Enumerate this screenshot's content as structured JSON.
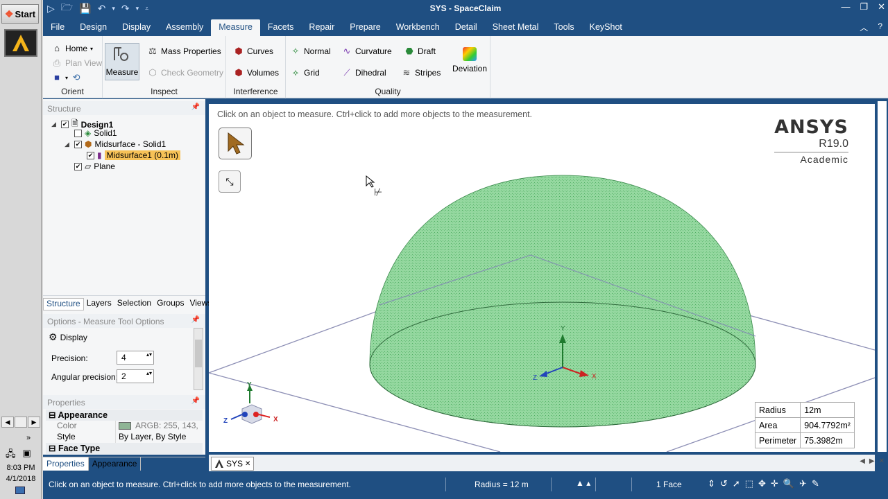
{
  "taskbar": {
    "start_label": "Start",
    "clock_time": "8:03 PM",
    "clock_date": "4/1/2018"
  },
  "window": {
    "title": "SYS - SpaceClaim"
  },
  "ribbon_tabs": [
    "File",
    "Design",
    "Display",
    "Assembly",
    "Measure",
    "Facets",
    "Repair",
    "Prepare",
    "Workbench",
    "Detail",
    "Sheet Metal",
    "Tools",
    "KeyShot"
  ],
  "ribbon": {
    "orient": {
      "label": "Orient",
      "home": "Home",
      "plan_view": "Plan View"
    },
    "inspect": {
      "label": "Inspect",
      "measure": "Measure",
      "mass_properties": "Mass Properties",
      "check_geometry": "Check Geometry"
    },
    "interference": {
      "label": "Interference",
      "curves": "Curves",
      "volumes": "Volumes"
    },
    "quality": {
      "label": "Quality",
      "normal": "Normal",
      "grid": "Grid",
      "curvature": "Curvature",
      "dihedral": "Dihedral",
      "draft": "Draft",
      "stripes": "Stripes",
      "deviation": "Deviation"
    }
  },
  "structure": {
    "header": "Structure",
    "design": "Design1",
    "solid": "Solid1",
    "midsurface": "Midsurface - Solid1",
    "midsurface_child": "Midsurface1 (0.1m)",
    "plane": "Plane"
  },
  "panel_tabs": [
    "Structure",
    "Layers",
    "Selection",
    "Groups",
    "Views"
  ],
  "options": {
    "header": "Options - Measure Tool Options",
    "display": "Display",
    "precision_label": "Precision:",
    "precision_value": "4",
    "angular_label": "Angular precision:",
    "angular_value": "2"
  },
  "properties": {
    "header": "Properties",
    "appearance": "Appearance",
    "color_key": "Color",
    "color_val": "ARGB: 255, 143,",
    "style_key": "Style",
    "style_val": "By Layer, By Style",
    "face_type": "Face Type",
    "swatch": "#8fb595"
  },
  "bottom_tabs": [
    "Properties",
    "Appearance"
  ],
  "viewport": {
    "hint": "Click on an object to measure.  Ctrl+click to add more objects to the measurement.",
    "logo_name": "ANSYS",
    "logo_version": "R19.0",
    "logo_edition": "Academic",
    "axis_x": "X",
    "axis_y": "Y",
    "axis_z": "Z"
  },
  "measure_table": [
    {
      "key": "Radius",
      "value": "12m"
    },
    {
      "key": "Area",
      "value": "904.7792m²"
    },
    {
      "key": "Perimeter",
      "value": "75.3982m"
    }
  ],
  "doc_tab": "SYS",
  "status": {
    "message": "Click on an object to measure.  Ctrl+click to add more objects to the measurement.",
    "radius": "Radius = 12 m",
    "selection": "1 Face"
  },
  "colors": {
    "accent": "#1f4f82",
    "dome": "#8fd49a",
    "highlight": "#f7c257"
  }
}
